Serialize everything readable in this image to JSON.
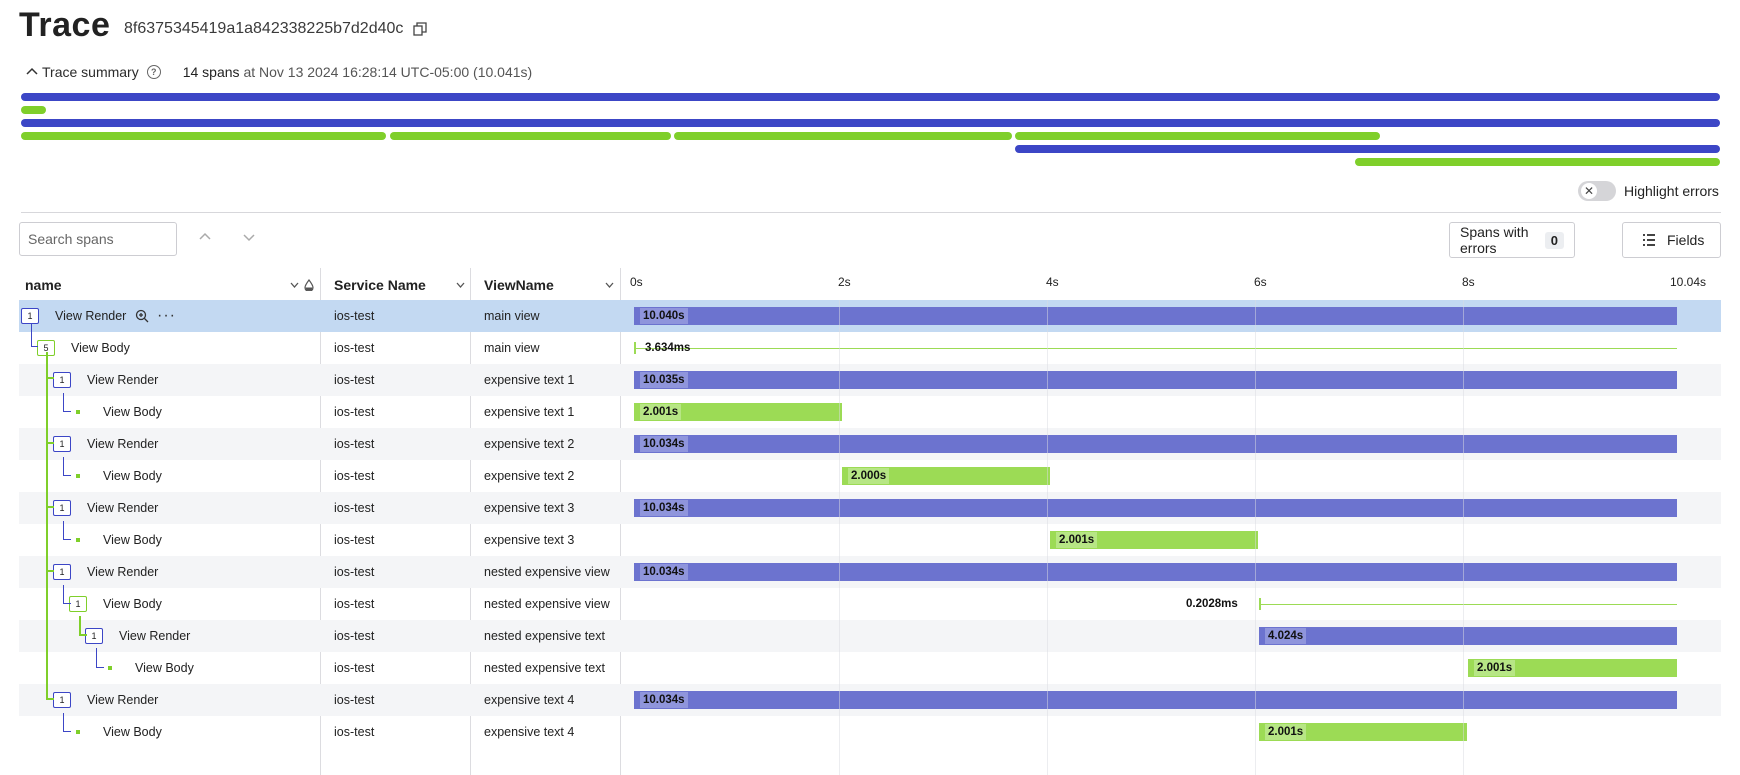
{
  "header": {
    "title": "Trace",
    "trace_id": "8f6375345419a1a842338225b7d2d40c"
  },
  "summary": {
    "toggle_label": "Trace summary",
    "span_count": "14 spans",
    "at_text": "at Nov 13 2024 16:28:14 UTC-05:00 (10.041s)"
  },
  "highlight_errors_label": "Highlight errors",
  "search": {
    "placeholder": "Search spans"
  },
  "toolbar": {
    "spans_with_errors_label": "Spans with errors",
    "spans_with_errors_count": "0",
    "fields_label": "Fields"
  },
  "columns": {
    "name": "name",
    "service": "Service Name",
    "view": "ViewName"
  },
  "timeline_ticks": [
    "0s",
    "2s",
    "4s",
    "6s",
    "8s",
    "10.04s"
  ],
  "colors": {
    "render": "#3c46c6",
    "body": "#7fcf2a",
    "selected_row": "#c3d9f2"
  },
  "rows": [
    {
      "name": "View Render",
      "badge": "1",
      "service": "ios-test",
      "view": "main view",
      "duration": "10.040s"
    },
    {
      "name": "View Body",
      "badge": "5",
      "service": "ios-test",
      "view": "main view",
      "duration": "3.634ms"
    },
    {
      "name": "View Render",
      "badge": "1",
      "service": "ios-test",
      "view": "expensive text 1",
      "duration": "10.035s"
    },
    {
      "name": "View Body",
      "badge": "",
      "service": "ios-test",
      "view": "expensive text 1",
      "duration": "2.001s"
    },
    {
      "name": "View Render",
      "badge": "1",
      "service": "ios-test",
      "view": "expensive text 2",
      "duration": "10.034s"
    },
    {
      "name": "View Body",
      "badge": "",
      "service": "ios-test",
      "view": "expensive text 2",
      "duration": "2.000s"
    },
    {
      "name": "View Render",
      "badge": "1",
      "service": "ios-test",
      "view": "expensive text 3",
      "duration": "10.034s"
    },
    {
      "name": "View Body",
      "badge": "",
      "service": "ios-test",
      "view": "expensive text 3",
      "duration": "2.001s"
    },
    {
      "name": "View Render",
      "badge": "1",
      "service": "ios-test",
      "view": "nested expensive view",
      "duration": "10.034s"
    },
    {
      "name": "View Body",
      "badge": "1",
      "service": "ios-test",
      "view": "nested expensive view",
      "duration": "0.2028ms"
    },
    {
      "name": "View Render",
      "badge": "1",
      "service": "ios-test",
      "view": "nested expensive text",
      "duration": "4.024s"
    },
    {
      "name": "View Body",
      "badge": "",
      "service": "ios-test",
      "view": "nested expensive text",
      "duration": "2.001s"
    },
    {
      "name": "View Render",
      "badge": "1",
      "service": "ios-test",
      "view": "expensive text 4",
      "duration": "10.034s"
    },
    {
      "name": "View Body",
      "badge": "",
      "service": "ios-test",
      "view": "expensive text 4",
      "duration": "2.001s"
    }
  ]
}
